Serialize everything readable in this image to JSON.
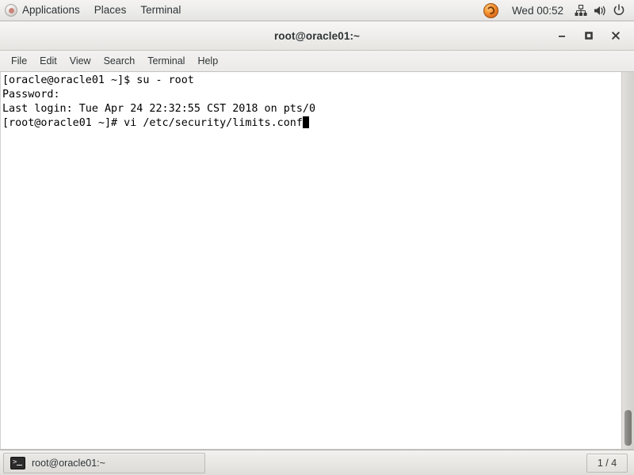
{
  "top_panel": {
    "applications_label": "Applications",
    "places_label": "Places",
    "terminal_label": "Terminal",
    "clock": "Wed 00:52",
    "icons": {
      "menu": "fedora-icon",
      "browser": "firefox-icon",
      "network": "network-icon",
      "volume": "volume-icon",
      "power": "power-icon"
    }
  },
  "window": {
    "title": "root@oracle01:~",
    "buttons": {
      "minimize": "minimize-button",
      "maximize": "maximize-button",
      "close": "close-button"
    }
  },
  "menubar": {
    "items": [
      {
        "label": "File"
      },
      {
        "label": "Edit"
      },
      {
        "label": "View"
      },
      {
        "label": "Search"
      },
      {
        "label": "Terminal"
      },
      {
        "label": "Help"
      }
    ]
  },
  "terminal": {
    "lines": [
      "[oracle@oracle01 ~]$ su - root",
      "Password:",
      "Last login: Tue Apr 24 22:32:55 CST 2018 on pts/0",
      "[root@oracle01 ~]# vi /etc/security/limits.conf"
    ],
    "text": "[oracle@oracle01 ~]$ su - root\nPassword:\nLast login: Tue Apr 24 22:32:55 CST 2018 on pts/0\n[root@oracle01 ~]# vi /etc/security/limits.conf",
    "foreground_color": "#000000",
    "background_color": "#ffffff",
    "cursor_style": "block"
  },
  "bottom_panel": {
    "task_label": "root@oracle01:~",
    "workspace": "1 / 4"
  }
}
